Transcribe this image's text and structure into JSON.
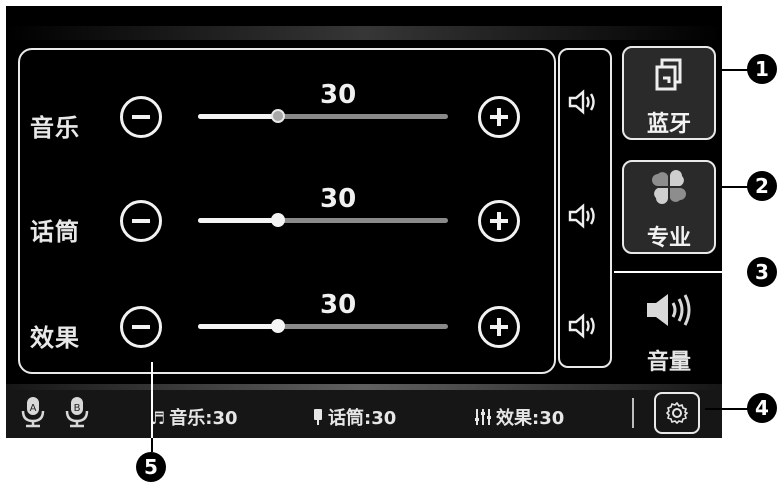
{
  "sliders": [
    {
      "label": "音乐",
      "value": "30",
      "level": 0.32,
      "thumb_style": "gray"
    },
    {
      "label": "话筒",
      "value": "30",
      "level": 0.32,
      "thumb_style": "white"
    },
    {
      "label": "效果",
      "value": "30",
      "level": 0.32,
      "thumb_style": "white"
    }
  ],
  "right_buttons": {
    "bluetooth_label": "蓝牙",
    "pro_label": "专业",
    "volume_label": "音量"
  },
  "bottom_bar": {
    "mic_a_letter": "A",
    "mic_b_letter": "B",
    "music_status": "音乐:30",
    "mic_status": "话筒:30",
    "effect_status": "效果:30"
  },
  "callouts": [
    "1",
    "2",
    "3",
    "4",
    "5"
  ],
  "icons": {
    "music": "music-note-icon",
    "mic": "microphone-icon",
    "effect": "equalizer-icon",
    "settings": "gear-icon",
    "speaker": "speaker-icon",
    "bluetooth": "bluetooth-switch-icon",
    "pro": "four-leaf-icon"
  }
}
